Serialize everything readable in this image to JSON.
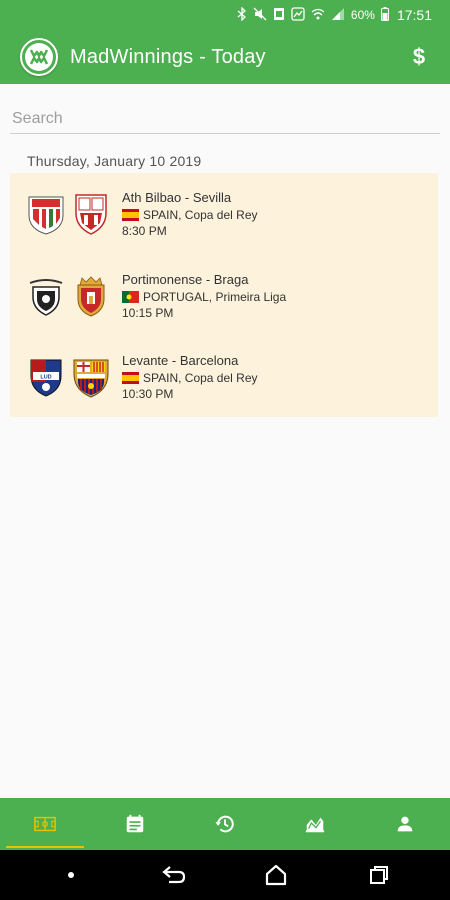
{
  "status_bar": {
    "battery": "60%",
    "time": "17:51"
  },
  "app_bar": {
    "logo_text": "MW",
    "title": "MadWinnings - Today",
    "dollar_icon": "$"
  },
  "search": {
    "placeholder": "Search"
  },
  "date_header": "Thursday, January 10 2019",
  "matches": [
    {
      "teams": "Ath Bilbao - Sevilla",
      "league": "SPAIN, Copa del Rey",
      "time": "8:30 PM",
      "flag": "spain"
    },
    {
      "teams": "Portimonense - Braga",
      "league": "PORTUGAL, Primeira Liga",
      "time": "10:15 PM",
      "flag": "portugal"
    },
    {
      "teams": "Levante - Barcelona",
      "league": "SPAIN, Copa del Rey",
      "time": "10:30 PM",
      "flag": "spain"
    }
  ],
  "bottom_nav": {
    "items": [
      "field-icon",
      "calendar-icon",
      "history-icon",
      "chart-icon",
      "profile-icon"
    ],
    "active_index": 0
  },
  "colors": {
    "primary": "#4caf50",
    "card_bg": "#fdf2dc",
    "active_indicator": "#e6c200"
  }
}
